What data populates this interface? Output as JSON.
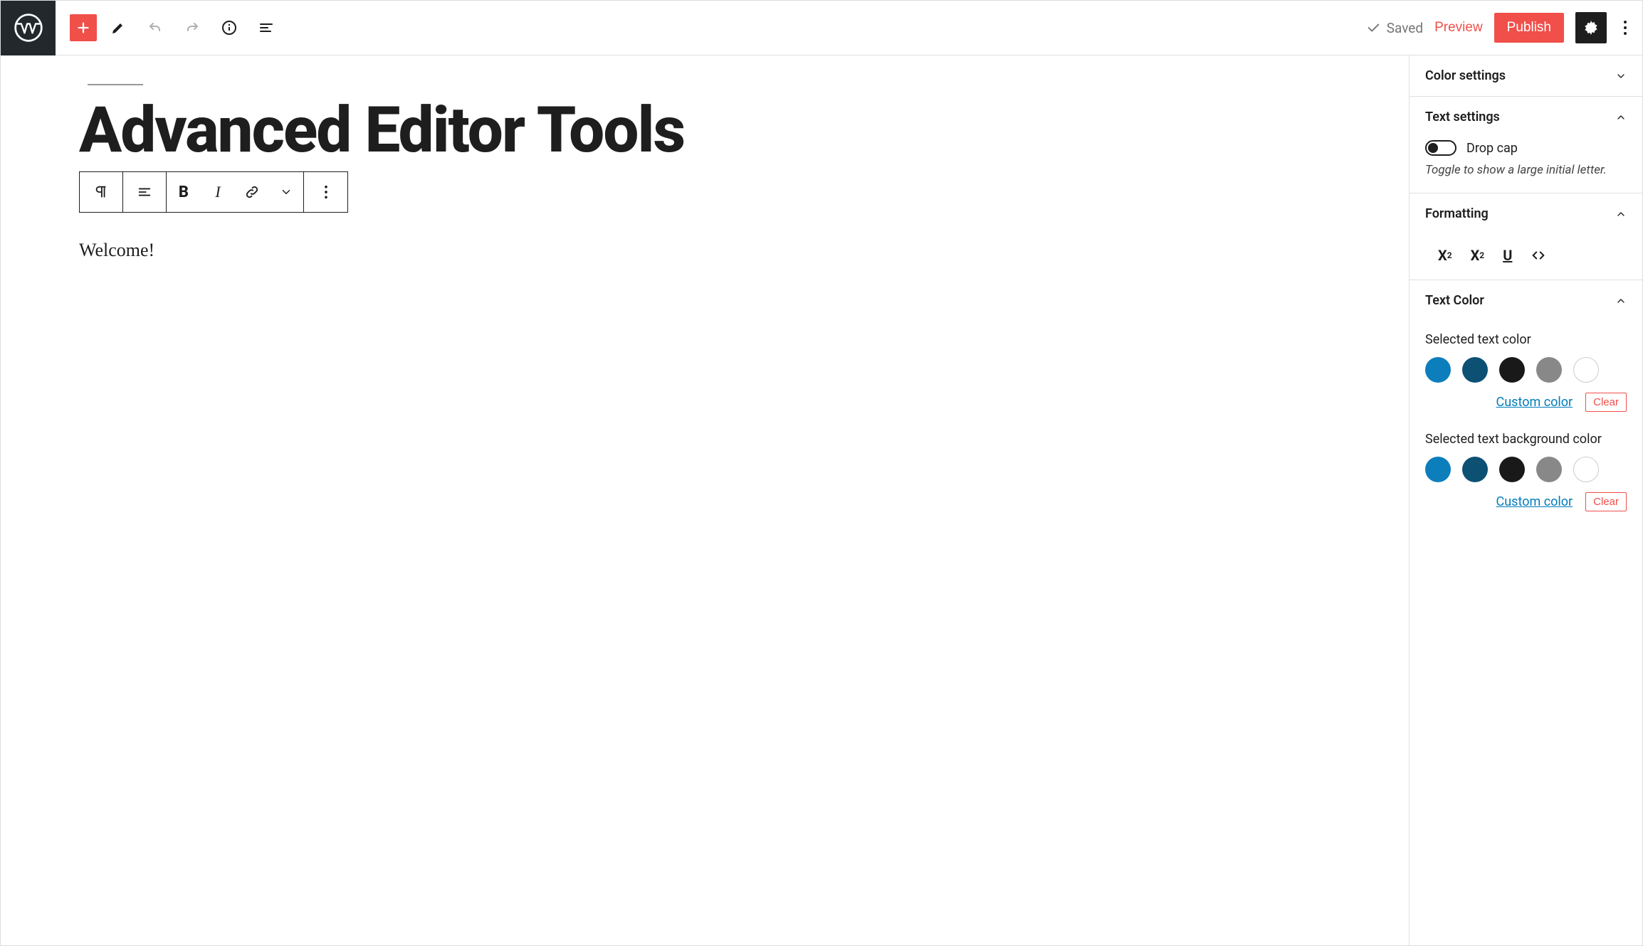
{
  "toolbar": {
    "saved_label": "Saved",
    "preview_label": "Preview",
    "publish_label": "Publish"
  },
  "post": {
    "title": "Advanced Editor Tools",
    "content": "Welcome!"
  },
  "sidebar": {
    "color_settings": {
      "title": "Color settings"
    },
    "text_settings": {
      "title": "Text settings",
      "drop_cap_label": "Drop cap",
      "drop_cap_hint": "Toggle to show a large initial letter."
    },
    "formatting": {
      "title": "Formatting"
    },
    "text_color": {
      "title": "Text Color",
      "selected_label": "Selected text color",
      "bg_label": "Selected text background color",
      "custom_label": "Custom color",
      "clear_label": "Clear",
      "swatches": [
        "#0d7ebc",
        "#0c5074",
        "#191919",
        "#888888",
        "#ffffff"
      ]
    }
  }
}
